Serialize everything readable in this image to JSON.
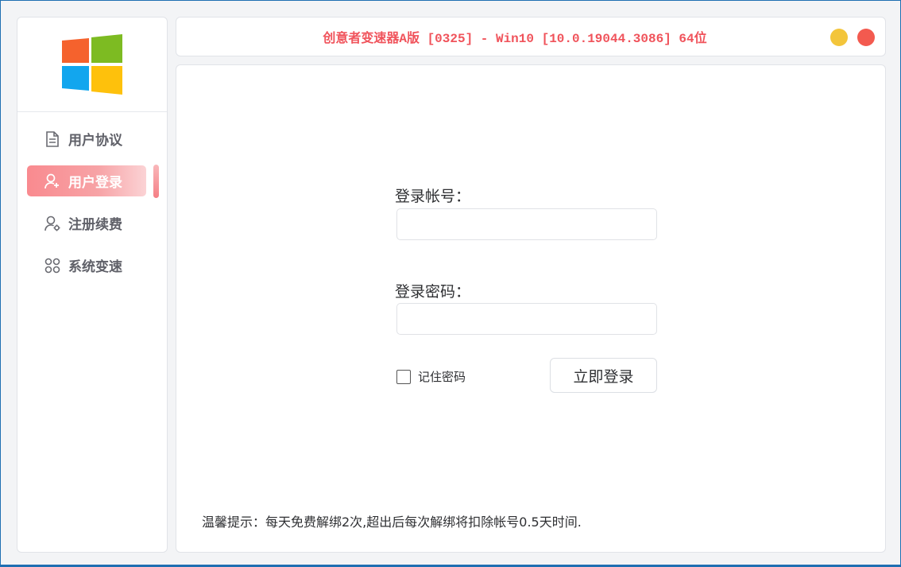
{
  "window": {
    "title": "创意者变速器A版 [0325]  - Win10 [10.0.19044.3086] 64位"
  },
  "colors": {
    "accent": "#f0535b",
    "minimize": "#f3c53b",
    "close": "#f35a4f",
    "active_nav_start": "#f98a8f",
    "active_nav_end": "#fbd3d5",
    "window_border": "#1f6fb2"
  },
  "sidebar": {
    "logo": "windows-logo",
    "items": [
      {
        "label": "用户协议",
        "icon": "document-icon",
        "active": false
      },
      {
        "label": "用户登录",
        "icon": "user-add-icon",
        "active": true
      },
      {
        "label": "注册续费",
        "icon": "user-settings-icon",
        "active": false
      },
      {
        "label": "系统变速",
        "icon": "grid-icon",
        "active": false
      }
    ]
  },
  "login": {
    "account_label": "登录帐号：",
    "account_value": "",
    "password_label": "登录密码：",
    "password_value": "",
    "remember_label": "记住密码",
    "remember_checked": false,
    "submit_label": "立即登录"
  },
  "footer": {
    "tip": "温馨提示：每天免费解绑2次,超出后每次解绑将扣除帐号0.5天时间."
  }
}
